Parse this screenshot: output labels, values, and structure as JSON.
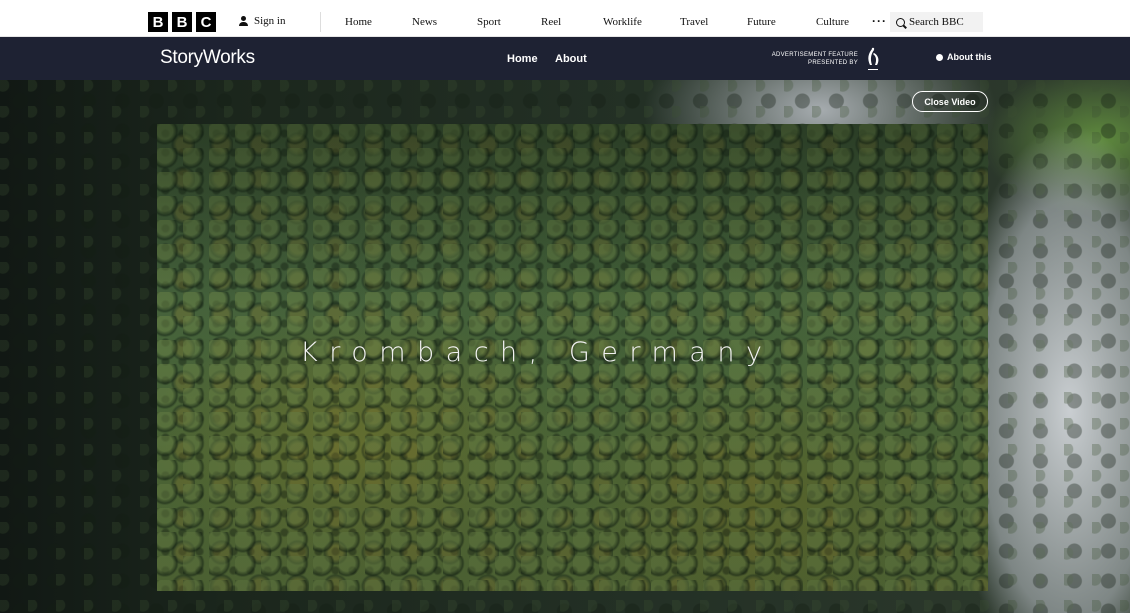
{
  "bbc_bar": {
    "logo_letters": [
      "B",
      "B",
      "C"
    ],
    "sign_in": "Sign in",
    "nav": [
      "Home",
      "News",
      "Sport",
      "Reel",
      "Worklife",
      "Travel",
      "Future",
      "Culture"
    ],
    "more": "···",
    "search_label": "Search BBC"
  },
  "storyworks_bar": {
    "logo": "StoryWorks",
    "nav": [
      "Home",
      "About"
    ],
    "advertisement_line1": "ADVERTISEMENT FEATURE",
    "advertisement_line2": "PRESENTED BY",
    "about_this": "About this"
  },
  "hero": {
    "close_video": "Close Video",
    "title": "Krombach, Germany"
  },
  "icons": {
    "sign_in": "person-icon",
    "search": "search-icon",
    "about_this": "info-dot-icon",
    "sponsor": "sponsor-logo"
  },
  "colors": {
    "storyworks_bar_bg": "#1e2233",
    "bbc_bar_bg": "#ffffff",
    "text_light": "#ffffff"
  }
}
